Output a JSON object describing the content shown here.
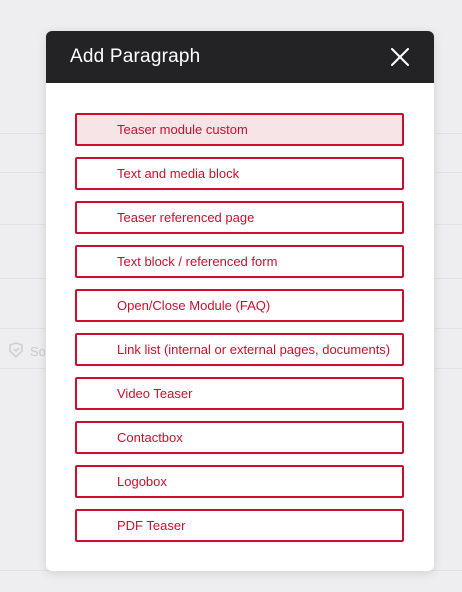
{
  "modal": {
    "title": "Add Paragraph",
    "close_icon": "close-icon",
    "options": [
      "Teaser module custom",
      "Text and media block",
      "Teaser referenced page",
      "Text block / referenced form",
      "Open/Close Module (FAQ)",
      "Link list (internal or external pages, documents)",
      "Video Teaser",
      "Contactbox",
      "Logobox",
      "PDF Teaser"
    ],
    "highlighted_index": 0
  },
  "background": {
    "fragment_text": "So",
    "fragment_icon": "settings-icon"
  },
  "colors": {
    "accent": "#c8102e",
    "header_bg": "#232326",
    "highlight_bg": "#f7e4e6"
  }
}
